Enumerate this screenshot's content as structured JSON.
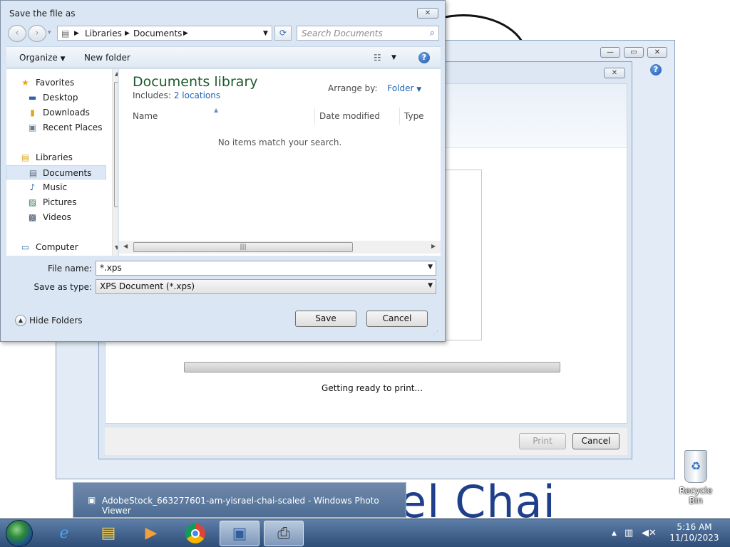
{
  "desktop": {
    "background_text": "el Chai",
    "recycle_bin_label": "Recycle Bin",
    "recycle_bin_icon": "recycle-bin-icon"
  },
  "print_dialog": {
    "status_text": "Getting ready to print...",
    "progress_fraction": 0.0,
    "print_label": "Print",
    "cancel_label": "Cancel",
    "close_glyph": "✕",
    "help_glyph": "?"
  },
  "save_dialog": {
    "title": "Save the file as",
    "close_glyph": "✕",
    "breadcrumb": [
      "Libraries",
      "Documents"
    ],
    "search_placeholder": "Search Documents",
    "toolbar": {
      "organize_label": "Organize",
      "new_folder_label": "New folder"
    },
    "nav_pane": {
      "favorites_label": "Favorites",
      "favorites_items": [
        "Desktop",
        "Downloads",
        "Recent Places"
      ],
      "libraries_label": "Libraries",
      "libraries_items": [
        "Documents",
        "Music",
        "Pictures",
        "Videos"
      ],
      "computer_label": "Computer",
      "selected_item": "Documents"
    },
    "content": {
      "library_title": "Documents library",
      "includes_label": "Includes:",
      "includes_link": "2 locations",
      "arrange_by_label": "Arrange by:",
      "arrange_by_value": "Folder",
      "columns": [
        "Name",
        "Date modified",
        "Type"
      ],
      "empty_message": "No items match your search."
    },
    "file_name_label": "File name:",
    "file_name_value": "*.xps",
    "save_as_type_label": "Save as type:",
    "save_as_type_value": "XPS Document (*.xps)",
    "hide_folders_label": "Hide Folders",
    "save_label": "Save",
    "cancel_label": "Cancel"
  },
  "taskbar": {
    "preview_title": "AdobeStock_663277601-am-yisrael-chai-scaled - Windows Photo Viewer",
    "time": "5:16 AM",
    "date": "11/10/2023",
    "pinned_icons": [
      "internet-explorer-icon",
      "file-explorer-icon",
      "media-player-icon",
      "chrome-icon",
      "photo-viewer-icon",
      "printer-icon"
    ]
  },
  "colors": {
    "accent_blue": "#1e63b5",
    "library_title_green": "#1e5a2b",
    "taskbar": "#2e4d78"
  }
}
